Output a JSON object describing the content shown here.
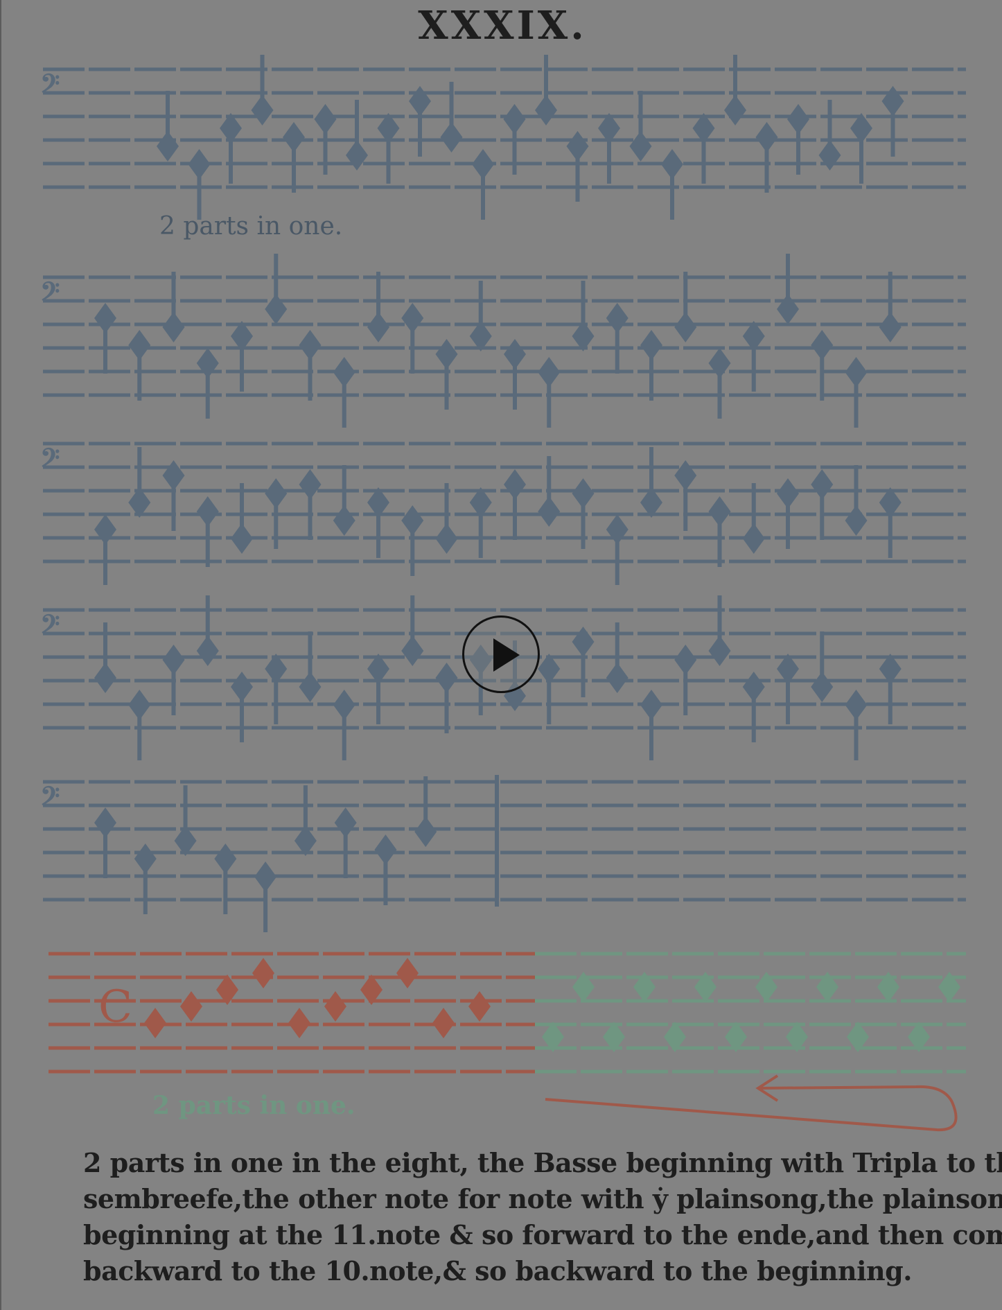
{
  "page": {
    "number": "XXXIX.",
    "caption_top": "2 parts in one.",
    "caption_bottom": "2 parts in one.",
    "description_lines": [
      "2 parts in one in the eight, the Basse beginning with Tripla to the",
      "sembreefe,the other note for note with ẏ plainsong,the plainsong,",
      "beginning at the 11.note & so forward to the ende,and then come",
      "backward to the 10.note,& so backward to the beginning."
    ]
  },
  "video": {
    "control_icon": "play-icon"
  },
  "colors": {
    "background": "#838383",
    "staff_ink": "#5a6a7a",
    "red_ink": "#a0594a",
    "green_ink": "#6f9681",
    "text": "#1e1e1e"
  }
}
